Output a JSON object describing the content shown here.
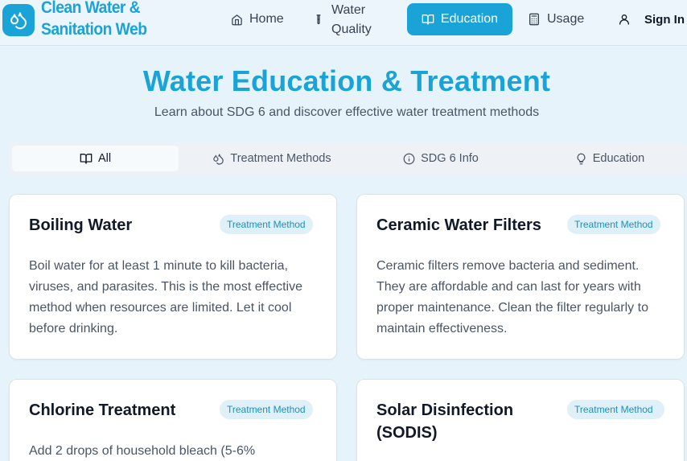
{
  "header": {
    "brand": "Clean Water & Sanitation Web",
    "nav": {
      "home": "Home",
      "water_quality": "Water Quality",
      "education": "Education",
      "usage": "Usage",
      "sign_in": "Sign In"
    },
    "accent": "#1aa3d6"
  },
  "hero": {
    "title": "Water Education & Treatment",
    "subtitle": "Learn about SDG 6 and discover effective water treatment methods"
  },
  "tabs": [
    {
      "label": "All",
      "icon": "book-open-icon",
      "active": true
    },
    {
      "label": "Treatment Methods",
      "icon": "droplets-icon",
      "active": false
    },
    {
      "label": "SDG 6 Info",
      "icon": "info-icon",
      "active": false
    },
    {
      "label": "Education",
      "icon": "lightbulb-icon",
      "active": false
    }
  ],
  "cards": [
    {
      "title": "Boiling Water",
      "badge": "Treatment Method",
      "body": "Boil water for at least 1 minute to kill bacteria, viruses, and parasites. This is the most effective method when resources are limited. Let it cool before drinking."
    },
    {
      "title": "Ceramic Water Filters",
      "badge": "Treatment Method",
      "body": "Ceramic filters remove bacteria and sediment. They are affordable and can last for years with proper maintenance. Clean the filter regularly to maintain effectiveness."
    },
    {
      "title": "Chlorine Treatment",
      "badge": "Treatment Method",
      "body": "Add 2 drops of household bleach (5-6%"
    },
    {
      "title": "Solar Disinfection (SODIS)",
      "badge": "Treatment Method",
      "body": ""
    }
  ]
}
